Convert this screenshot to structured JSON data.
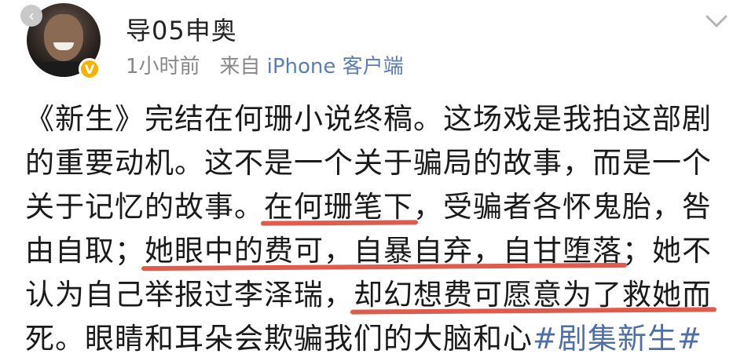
{
  "header": {
    "username": "导05申奥",
    "time": "1小时前",
    "from_prefix": "来自",
    "source": "iPhone 客户端"
  },
  "post": {
    "line1": "《新生》完结在何珊小说终稿。这场戏是我拍这部剧",
    "line2": "的重要动机。这不是一个关于骗局的故事，而是一个",
    "line3_a": "关于记忆的故事。",
    "line3_hl": "在何珊笔下",
    "line3_b": "，受骗者各怀鬼胎，咎",
    "line4_a": "由自取；",
    "line4_hl": "她眼中的费可，自暴自弃，自甘堕落",
    "line4_b": "；她不",
    "line5_a": "认为自己举报过李泽瑞，",
    "line5_hl": "却幻想费可愿意为了救她而",
    "line6_a": "死。眼睛和耳朵会欺骗我们的大脑和心",
    "line6_tag": "#剧集新生#"
  },
  "colors": {
    "accent_link": "#5a7db6",
    "underline": "#d94a3a",
    "verified": "#f5b300"
  },
  "icons": {
    "back": "back-arrow-icon",
    "menu": "chevron-down-icon",
    "verified": "verified-badge-icon"
  }
}
